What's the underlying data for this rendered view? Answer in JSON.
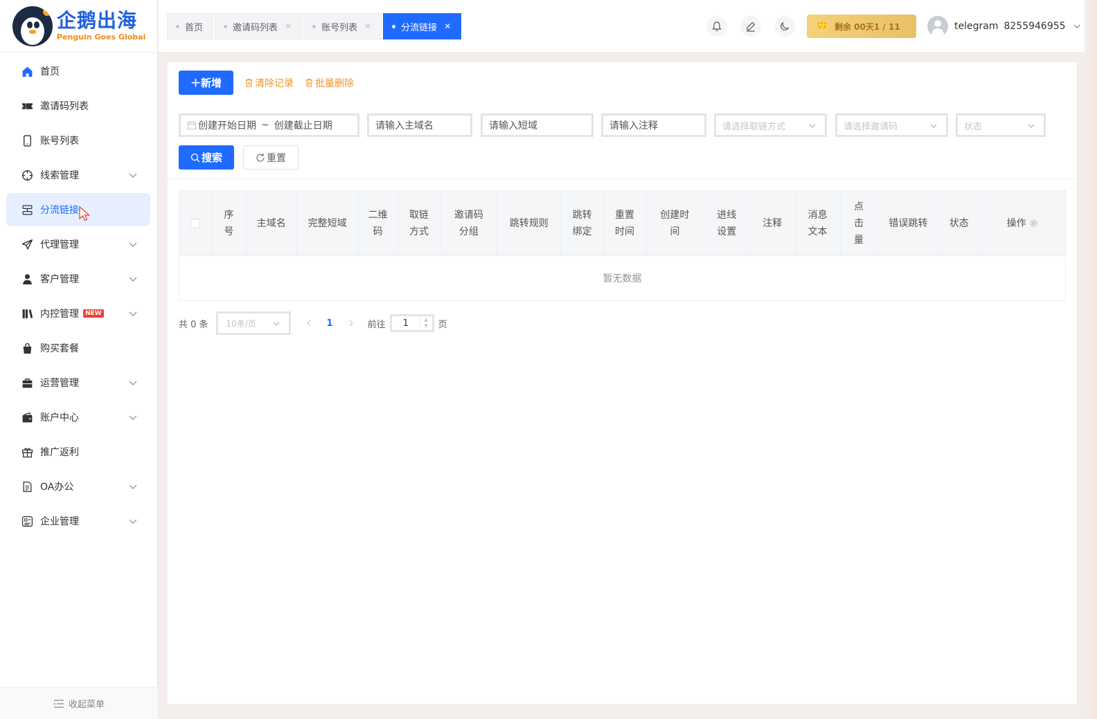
{
  "brand": {
    "name_cn": "企鹅出海",
    "name_en": "Penguin Goes Global"
  },
  "sidebar": {
    "items": [
      {
        "label": "首页",
        "icon": "home-icon",
        "has_arrow": false
      },
      {
        "label": "邀请码列表",
        "icon": "ticket-icon",
        "has_arrow": false
      },
      {
        "label": "账号列表",
        "icon": "phone-icon",
        "has_arrow": false
      },
      {
        "label": "线索管理",
        "icon": "target-icon",
        "has_arrow": true
      },
      {
        "label": "分流链接",
        "icon": "branch-icon",
        "has_arrow": false,
        "active": true
      },
      {
        "label": "代理管理",
        "icon": "send-icon",
        "has_arrow": true
      },
      {
        "label": "客户管理",
        "icon": "user-icon",
        "has_arrow": true
      },
      {
        "label": "内控管理",
        "icon": "books-icon",
        "has_arrow": true,
        "badge": "NEW"
      },
      {
        "label": "购买套餐",
        "icon": "bag-icon",
        "has_arrow": false
      },
      {
        "label": "运营管理",
        "icon": "briefcase-icon",
        "has_arrow": true
      },
      {
        "label": "账户中心",
        "icon": "wallet-icon",
        "has_arrow": true
      },
      {
        "label": "推广返利",
        "icon": "gift-icon",
        "has_arrow": false
      },
      {
        "label": "OA办公",
        "icon": "document-icon",
        "has_arrow": true
      },
      {
        "label": "企业管理",
        "icon": "enterprise-icon",
        "has_arrow": true
      }
    ],
    "collapse_label": "收起菜单"
  },
  "tabs": [
    {
      "label": "首页",
      "active": false
    },
    {
      "label": "邀请码列表",
      "active": false
    },
    {
      "label": "账号列表",
      "active": false
    },
    {
      "label": "分流链接",
      "active": true
    }
  ],
  "header": {
    "vip_text": "剩余 00天1 / 11",
    "username": "telegram",
    "user_id": "8255946955"
  },
  "toolbar": {
    "add_label": "＋新增",
    "clear_label": "清除记录",
    "batch_delete_label": "批量删除"
  },
  "filters": {
    "date_start": "创建开始日期",
    "date_sep": "~",
    "date_end": "创建截止日期",
    "domain_placeholder": "请输入主域名",
    "short_placeholder": "请输入短域",
    "note_placeholder": "请输入注释",
    "method_placeholder": "请选择取链方式",
    "invite_placeholder": "请选择邀请码",
    "status_placeholder": "状态",
    "search_label": "搜索",
    "reset_label": "重置"
  },
  "table": {
    "columns": [
      "序号",
      "主域名",
      "完整短域",
      "二维码",
      "取链方式",
      "邀请码 分组",
      "跳转规则",
      "跳转绑定",
      "重置时间",
      "创建时间",
      "进线设置",
      "注释",
      "消息文本",
      "点击量",
      "错误跳转",
      "状态",
      "操作"
    ],
    "empty_text": "暂无数据"
  },
  "pagination": {
    "total_text": "共 0 条",
    "page_size": "10条/页",
    "current_page": "1",
    "goto_label": "前往",
    "goto_value": "1",
    "goto_unit": "页"
  },
  "colors": {
    "primary": "#1f6bff",
    "warning": "#f0962a",
    "vip_gold": "#e8c067",
    "badge_red": "#f04134"
  }
}
